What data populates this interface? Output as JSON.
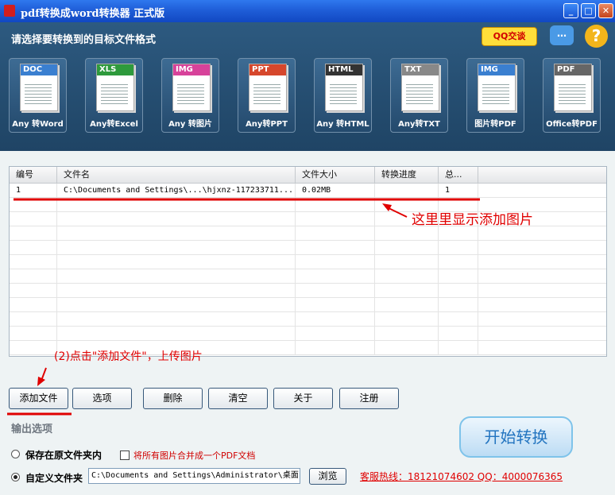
{
  "window": {
    "title": "pdf转换成word转换器 正式版"
  },
  "header": {
    "title": "请选择要转换到的目标文件格式",
    "qq_label": "QQ交谈",
    "formats": [
      {
        "tag": "DOC",
        "label": "Any 转Word",
        "color": "#3a7fd0"
      },
      {
        "tag": "XLS",
        "label": "Any转Excel",
        "color": "#2e9a3c"
      },
      {
        "tag": "IMG",
        "label": "Any 转图片",
        "color": "#d7429a"
      },
      {
        "tag": "PPT",
        "label": "Any转PPT",
        "color": "#d6472c"
      },
      {
        "tag": "HTML",
        "label": "Any 转HTML",
        "color": "#333333"
      },
      {
        "tag": "TXT",
        "label": "Any转TXT",
        "color": "#888888"
      },
      {
        "tag": "IMG",
        "label": "图片转PDF",
        "color": "#3a7fd0"
      },
      {
        "tag": "PDF",
        "label": "Office转PDF",
        "color": "#666666"
      }
    ]
  },
  "table": {
    "columns": [
      "编号",
      "文件名",
      "文件大小",
      "转换进度",
      "总..."
    ],
    "rows": [
      {
        "num": "1",
        "name": "C:\\Documents and Settings\\...\\hjxnz-117233711...",
        "size": "0.02MB",
        "progress": "",
        "total": "1"
      }
    ]
  },
  "annotations": {
    "table_note": "这里里显示添加图片",
    "upload_note": "(2)点击\"添加文件\"，上传图片"
  },
  "toolbar": {
    "add": "添加文件",
    "options": "选项",
    "delete": "删除",
    "clear": "清空",
    "about": "关于",
    "register": "注册"
  },
  "output": {
    "section_title": "输出选项",
    "save_original": "保存在原文件夹内",
    "merge_label": "将所有图片合并成一个PDF文档",
    "custom_folder": "自定义文件夹",
    "path_value": "C:\\Documents and Settings\\Administrator\\桌面",
    "browse": "浏览"
  },
  "start_button": "开始转换",
  "hotline": "客服热线：18121074602 QQ：4000076365"
}
